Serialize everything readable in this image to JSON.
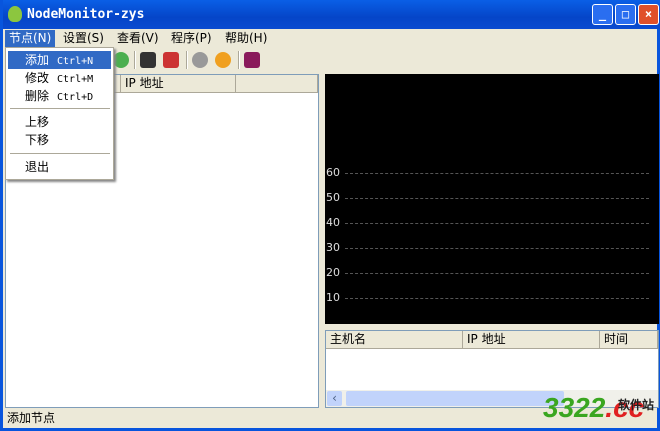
{
  "window": {
    "title": "NodeMonitor-zys",
    "minimize": "_",
    "maximize": "□",
    "close": "×"
  },
  "menubar": [
    {
      "label": "节点(N)"
    },
    {
      "label": "设置(S)"
    },
    {
      "label": "查看(V)"
    },
    {
      "label": "程序(P)"
    },
    {
      "label": "帮助(H)"
    }
  ],
  "node_menu": {
    "items": [
      {
        "label": "添加",
        "shortcut": "Ctrl+N"
      },
      {
        "label": "修改",
        "shortcut": "Ctrl+M"
      },
      {
        "label": "删除",
        "shortcut": "Ctrl+D"
      },
      {
        "label": "上移"
      },
      {
        "label": "下移"
      },
      {
        "label": "退出"
      }
    ]
  },
  "left_table": {
    "columns": [
      "",
      "IP 地址",
      ""
    ]
  },
  "chart": {
    "y_ticks": [
      "60",
      "50",
      "40",
      "30",
      "20",
      "10"
    ]
  },
  "right_table": {
    "columns": [
      "主机名",
      "IP 地址",
      "时间"
    ]
  },
  "status": {
    "text": "添加节点"
  },
  "watermark": {
    "text": "3322",
    "cc": ".cc",
    "site": "软件站"
  }
}
